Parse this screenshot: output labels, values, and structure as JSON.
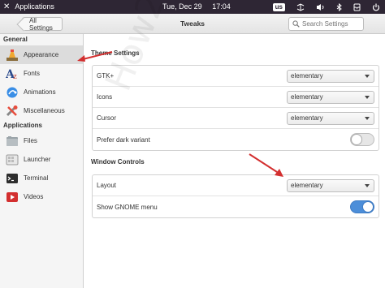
{
  "top_panel": {
    "app_menu": "Applications",
    "day": "Tue, Dec 29",
    "time": "17:04",
    "keyboard_layout": "us"
  },
  "header": {
    "back_label": "All Settings",
    "title": "Tweaks",
    "search_placeholder": "Search Settings"
  },
  "sidebar": {
    "section_general": "General",
    "general_items": [
      {
        "label": "Appearance",
        "icon": "appearance-icon",
        "selected": true
      },
      {
        "label": "Fonts",
        "icon": "fonts-icon"
      },
      {
        "label": "Animations",
        "icon": "animations-icon"
      },
      {
        "label": "Miscellaneous",
        "icon": "miscellaneous-icon"
      }
    ],
    "section_applications": "Applications",
    "application_items": [
      {
        "label": "Files",
        "icon": "files-icon"
      },
      {
        "label": "Launcher",
        "icon": "launcher-icon"
      },
      {
        "label": "Terminal",
        "icon": "terminal-icon"
      },
      {
        "label": "Videos",
        "icon": "videos-icon"
      }
    ]
  },
  "theme_settings": {
    "title": "Theme Settings",
    "rows": [
      {
        "label": "GTK+",
        "value": "elementary"
      },
      {
        "label": "Icons",
        "value": "elementary"
      },
      {
        "label": "Cursor",
        "value": "elementary"
      },
      {
        "label": "Prefer dark variant",
        "toggle": false
      }
    ]
  },
  "window_controls": {
    "title": "Window Controls",
    "rows": [
      {
        "label": "Layout",
        "value": "elementary"
      },
      {
        "label": "Show GNOME menu",
        "toggle": true
      }
    ]
  },
  "watermark": "How2shout",
  "colors": {
    "panel": "#2e2634",
    "switch_on": "#4c8ed9",
    "annotation_arrow": "#d32f2f"
  }
}
